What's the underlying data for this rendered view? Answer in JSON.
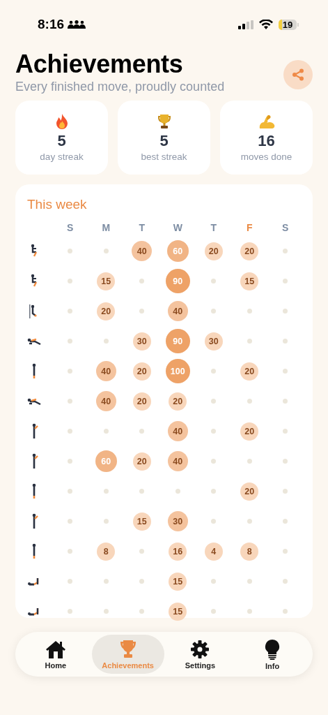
{
  "status_bar": {
    "time": "8:16",
    "battery": "19"
  },
  "header": {
    "title": "Achievements",
    "subtitle": "Every finished move, proudly counted"
  },
  "stats": [
    {
      "kind": "flame",
      "value": "5",
      "label": "day streak"
    },
    {
      "kind": "trophy",
      "value": "5",
      "label": "best streak"
    },
    {
      "kind": "arm",
      "value": "16",
      "label": "moves done"
    }
  ],
  "week": {
    "title": "This week",
    "days": [
      {
        "label": "S",
        "today": false
      },
      {
        "label": "M",
        "today": false
      },
      {
        "label": "T",
        "today": false
      },
      {
        "label": "W",
        "today": false
      },
      {
        "label": "T",
        "today": false
      },
      {
        "label": "F",
        "today": true
      },
      {
        "label": "S",
        "today": false
      }
    ],
    "rows": [
      {
        "kind": "squat",
        "cells": [
          {
            "kind": "empty"
          },
          {
            "kind": "empty"
          },
          {
            "kind": "mid",
            "value": "40"
          },
          {
            "kind": "high",
            "value": "60"
          },
          {
            "kind": "low",
            "value": "20"
          },
          {
            "kind": "low",
            "value": "20"
          },
          {
            "kind": "empty"
          }
        ]
      },
      {
        "kind": "squat",
        "cells": [
          {
            "kind": "empty"
          },
          {
            "kind": "low",
            "value": "15"
          },
          {
            "kind": "empty"
          },
          {
            "kind": "max",
            "value": "90"
          },
          {
            "kind": "empty"
          },
          {
            "kind": "low",
            "value": "15"
          },
          {
            "kind": "empty"
          }
        ]
      },
      {
        "kind": "wall",
        "cells": [
          {
            "kind": "empty"
          },
          {
            "kind": "low",
            "value": "20"
          },
          {
            "kind": "empty"
          },
          {
            "kind": "mid",
            "value": "40"
          },
          {
            "kind": "empty"
          },
          {
            "kind": "empty"
          },
          {
            "kind": "empty"
          }
        ]
      },
      {
        "kind": "lunge",
        "cells": [
          {
            "kind": "empty"
          },
          {
            "kind": "empty"
          },
          {
            "kind": "low",
            "value": "30"
          },
          {
            "kind": "max",
            "value": "90"
          },
          {
            "kind": "low",
            "value": "30"
          },
          {
            "kind": "empty"
          },
          {
            "kind": "empty"
          }
        ]
      },
      {
        "kind": "stand",
        "cells": [
          {
            "kind": "empty"
          },
          {
            "kind": "mid",
            "value": "40"
          },
          {
            "kind": "low",
            "value": "20"
          },
          {
            "kind": "max",
            "value": "100"
          },
          {
            "kind": "empty"
          },
          {
            "kind": "low",
            "value": "20"
          },
          {
            "kind": "empty"
          }
        ]
      },
      {
        "kind": "lunge",
        "cells": [
          {
            "kind": "empty"
          },
          {
            "kind": "mid",
            "value": "40"
          },
          {
            "kind": "low",
            "value": "20"
          },
          {
            "kind": "low",
            "value": "20"
          },
          {
            "kind": "empty"
          },
          {
            "kind": "empty"
          },
          {
            "kind": "empty"
          }
        ]
      },
      {
        "kind": "arm",
        "cells": [
          {
            "kind": "empty"
          },
          {
            "kind": "empty"
          },
          {
            "kind": "empty"
          },
          {
            "kind": "mid",
            "value": "40"
          },
          {
            "kind": "empty"
          },
          {
            "kind": "low",
            "value": "20"
          },
          {
            "kind": "empty"
          }
        ]
      },
      {
        "kind": "arm",
        "cells": [
          {
            "kind": "empty"
          },
          {
            "kind": "high",
            "value": "60"
          },
          {
            "kind": "low",
            "value": "20"
          },
          {
            "kind": "mid",
            "value": "40"
          },
          {
            "kind": "empty"
          },
          {
            "kind": "empty"
          },
          {
            "kind": "empty"
          }
        ]
      },
      {
        "kind": "stand",
        "cells": [
          {
            "kind": "empty"
          },
          {
            "kind": "empty"
          },
          {
            "kind": "empty"
          },
          {
            "kind": "empty"
          },
          {
            "kind": "empty"
          },
          {
            "kind": "low",
            "value": "20"
          },
          {
            "kind": "empty"
          }
        ]
      },
      {
        "kind": "arm",
        "cells": [
          {
            "kind": "empty"
          },
          {
            "kind": "empty"
          },
          {
            "kind": "low",
            "value": "15"
          },
          {
            "kind": "mid",
            "value": "30"
          },
          {
            "kind": "empty"
          },
          {
            "kind": "empty"
          },
          {
            "kind": "empty"
          }
        ]
      },
      {
        "kind": "stand",
        "cells": [
          {
            "kind": "empty"
          },
          {
            "kind": "low",
            "value": "8"
          },
          {
            "kind": "empty"
          },
          {
            "kind": "low",
            "value": "16"
          },
          {
            "kind": "low",
            "value": "4"
          },
          {
            "kind": "low",
            "value": "8"
          },
          {
            "kind": "empty"
          }
        ]
      },
      {
        "kind": "floor",
        "cells": [
          {
            "kind": "empty"
          },
          {
            "kind": "empty"
          },
          {
            "kind": "empty"
          },
          {
            "kind": "low",
            "value": "15"
          },
          {
            "kind": "empty"
          },
          {
            "kind": "empty"
          },
          {
            "kind": "empty"
          }
        ]
      },
      {
        "kind": "floor",
        "cells": [
          {
            "kind": "empty"
          },
          {
            "kind": "empty"
          },
          {
            "kind": "empty"
          },
          {
            "kind": "low",
            "value": "15"
          },
          {
            "kind": "empty"
          },
          {
            "kind": "empty"
          },
          {
            "kind": "empty"
          }
        ]
      }
    ]
  },
  "tabs": [
    {
      "kind": "home",
      "label": "Home",
      "selected": false
    },
    {
      "kind": "trophy",
      "label": "Achievements",
      "selected": true
    },
    {
      "kind": "gear",
      "label": "Settings",
      "selected": false
    },
    {
      "kind": "bulb",
      "label": "Info",
      "selected": false
    }
  ]
}
